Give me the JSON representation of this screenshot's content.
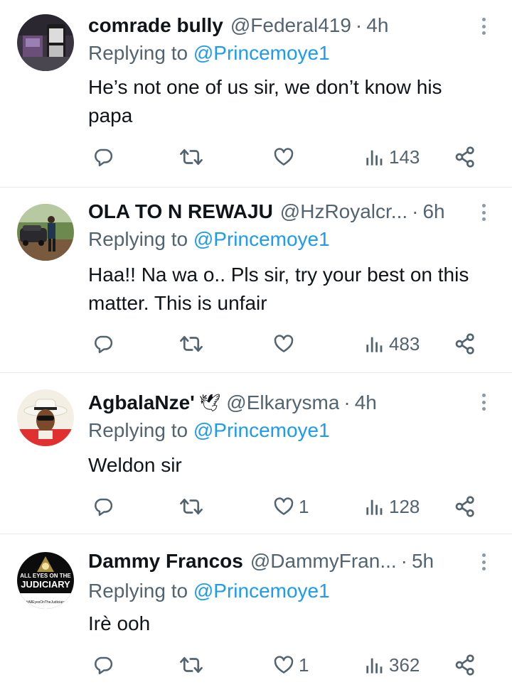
{
  "replies": [
    {
      "name": "comrade bully",
      "handle": "@Federal419",
      "dot": "·",
      "time": "4h",
      "replying_prefix": "Replying to ",
      "replying_to": "@Princemoye1",
      "text": "He’s not one of us sir, we don’t know his papa",
      "likes": "",
      "views": "143"
    },
    {
      "name": "OLA TO N REWAJU",
      "handle": "@HzRoyalcr...",
      "dot": "·",
      "time": "6h",
      "replying_prefix": "Replying to ",
      "replying_to": "@Princemoye1",
      "text": "Haa!! Na wa o.. Pls sir, try your best on this matter. This is unfair",
      "likes": "",
      "views": "483"
    },
    {
      "name": "AgbalaNze'",
      "name_emoji": "🕊",
      "handle": "@Elkarysma",
      "dot": "·",
      "time": "4h",
      "replying_prefix": "Replying to ",
      "replying_to": "@Princemoye1",
      "text": "Weldon sir",
      "likes": "1",
      "views": "128"
    },
    {
      "name": "Dammy Francos",
      "handle": "@DammyFran...",
      "dot": "·",
      "time": "5h",
      "replying_prefix": "Replying to ",
      "replying_to": "@Princemoye1",
      "text": "Irè ooh",
      "likes": "1",
      "views": "362",
      "avatar_text": [
        "ALL EYES ON THE",
        "JUDICIARY",
        "#AllEyesOnTheJudiciary"
      ]
    }
  ],
  "colors": {
    "text": "#0f1419",
    "secondary": "#536471",
    "link": "#1d9bf0",
    "divider": "#e6e9eb"
  },
  "icons": [
    "reply-icon",
    "retweet-icon",
    "like-icon",
    "views-icon",
    "share-icon",
    "more-icon"
  ]
}
